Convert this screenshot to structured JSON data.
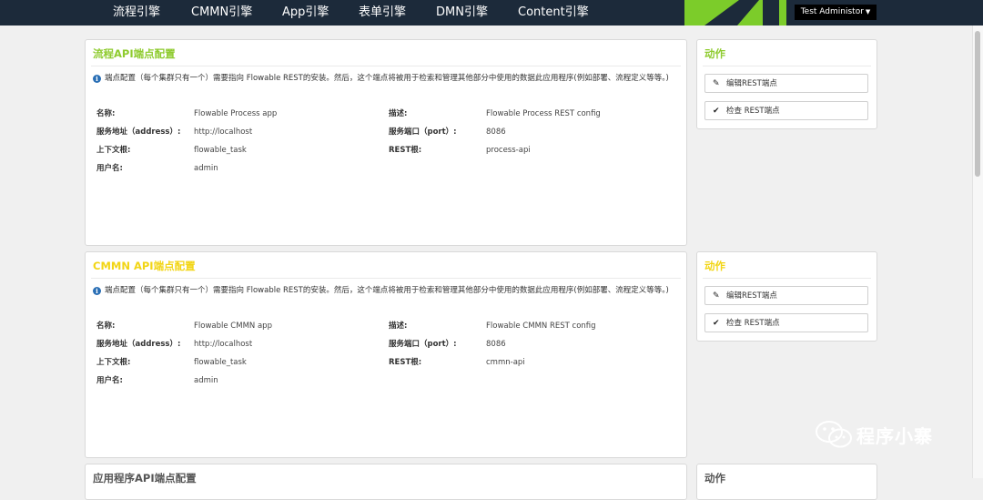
{
  "nav": {
    "items": [
      "流程引擎",
      "CMMN引擎",
      "App引擎",
      "表单引擎",
      "DMN引擎",
      "Content引擎"
    ],
    "user": "Test Administor"
  },
  "panels": [
    {
      "title": "流程API端点配置",
      "info": "端点配置（每个集群只有一个）需要指向 Flowable REST的安装。然后，这个端点将被用于检索和管理其他部分中使用的数据此应用程序(例如部署、流程定义等等。)",
      "fields": {
        "name_label": "名称:",
        "name_value": "Flowable Process app",
        "desc_label": "描述:",
        "desc_value": "Flowable Process REST config",
        "address_label": "服务地址（address）:",
        "address_value": "http://localhost",
        "port_label": "服务端口（port）:",
        "port_value": "8086",
        "context_label": "上下文根:",
        "context_value": "flowable_task",
        "rest_label": "REST根:",
        "rest_value": "process-api",
        "user_label": "用户名:",
        "user_value": "admin"
      }
    },
    {
      "title": "CMMN API端点配置",
      "info": "端点配置（每个集群只有一个）需要指向 Flowable REST的安装。然后，这个端点将被用于检索和管理其他部分中使用的数据此应用程序(例如部署、流程定义等等。)",
      "fields": {
        "name_label": "名称:",
        "name_value": "Flowable CMMN app",
        "desc_label": "描述:",
        "desc_value": "Flowable CMMN REST config",
        "address_label": "服务地址（address）:",
        "address_value": "http://localhost",
        "port_label": "服务端口（port）:",
        "port_value": "8086",
        "context_label": "上下文根:",
        "context_value": "flowable_task",
        "rest_label": "REST根:",
        "rest_value": "cmmn-api",
        "user_label": "用户名:",
        "user_value": "admin"
      }
    },
    {
      "title": "应用程序API端点配置"
    }
  ],
  "actions": [
    {
      "title": "动作",
      "edit": "编辑REST端点",
      "check": "检查 REST端点"
    },
    {
      "title": "动作",
      "edit": "编辑REST端点",
      "check": "检查 REST端点"
    },
    {
      "title": "动作"
    }
  ],
  "watermark": "程序小寨",
  "colors": {
    "nav_bg": "#1c2a3a",
    "accent_green": "#8ecb2e",
    "accent_yellow": "#f2d514"
  },
  "icons": [
    "pencil-icon",
    "check-icon",
    "info-icon",
    "caret-down-icon",
    "wechat-icon"
  ]
}
